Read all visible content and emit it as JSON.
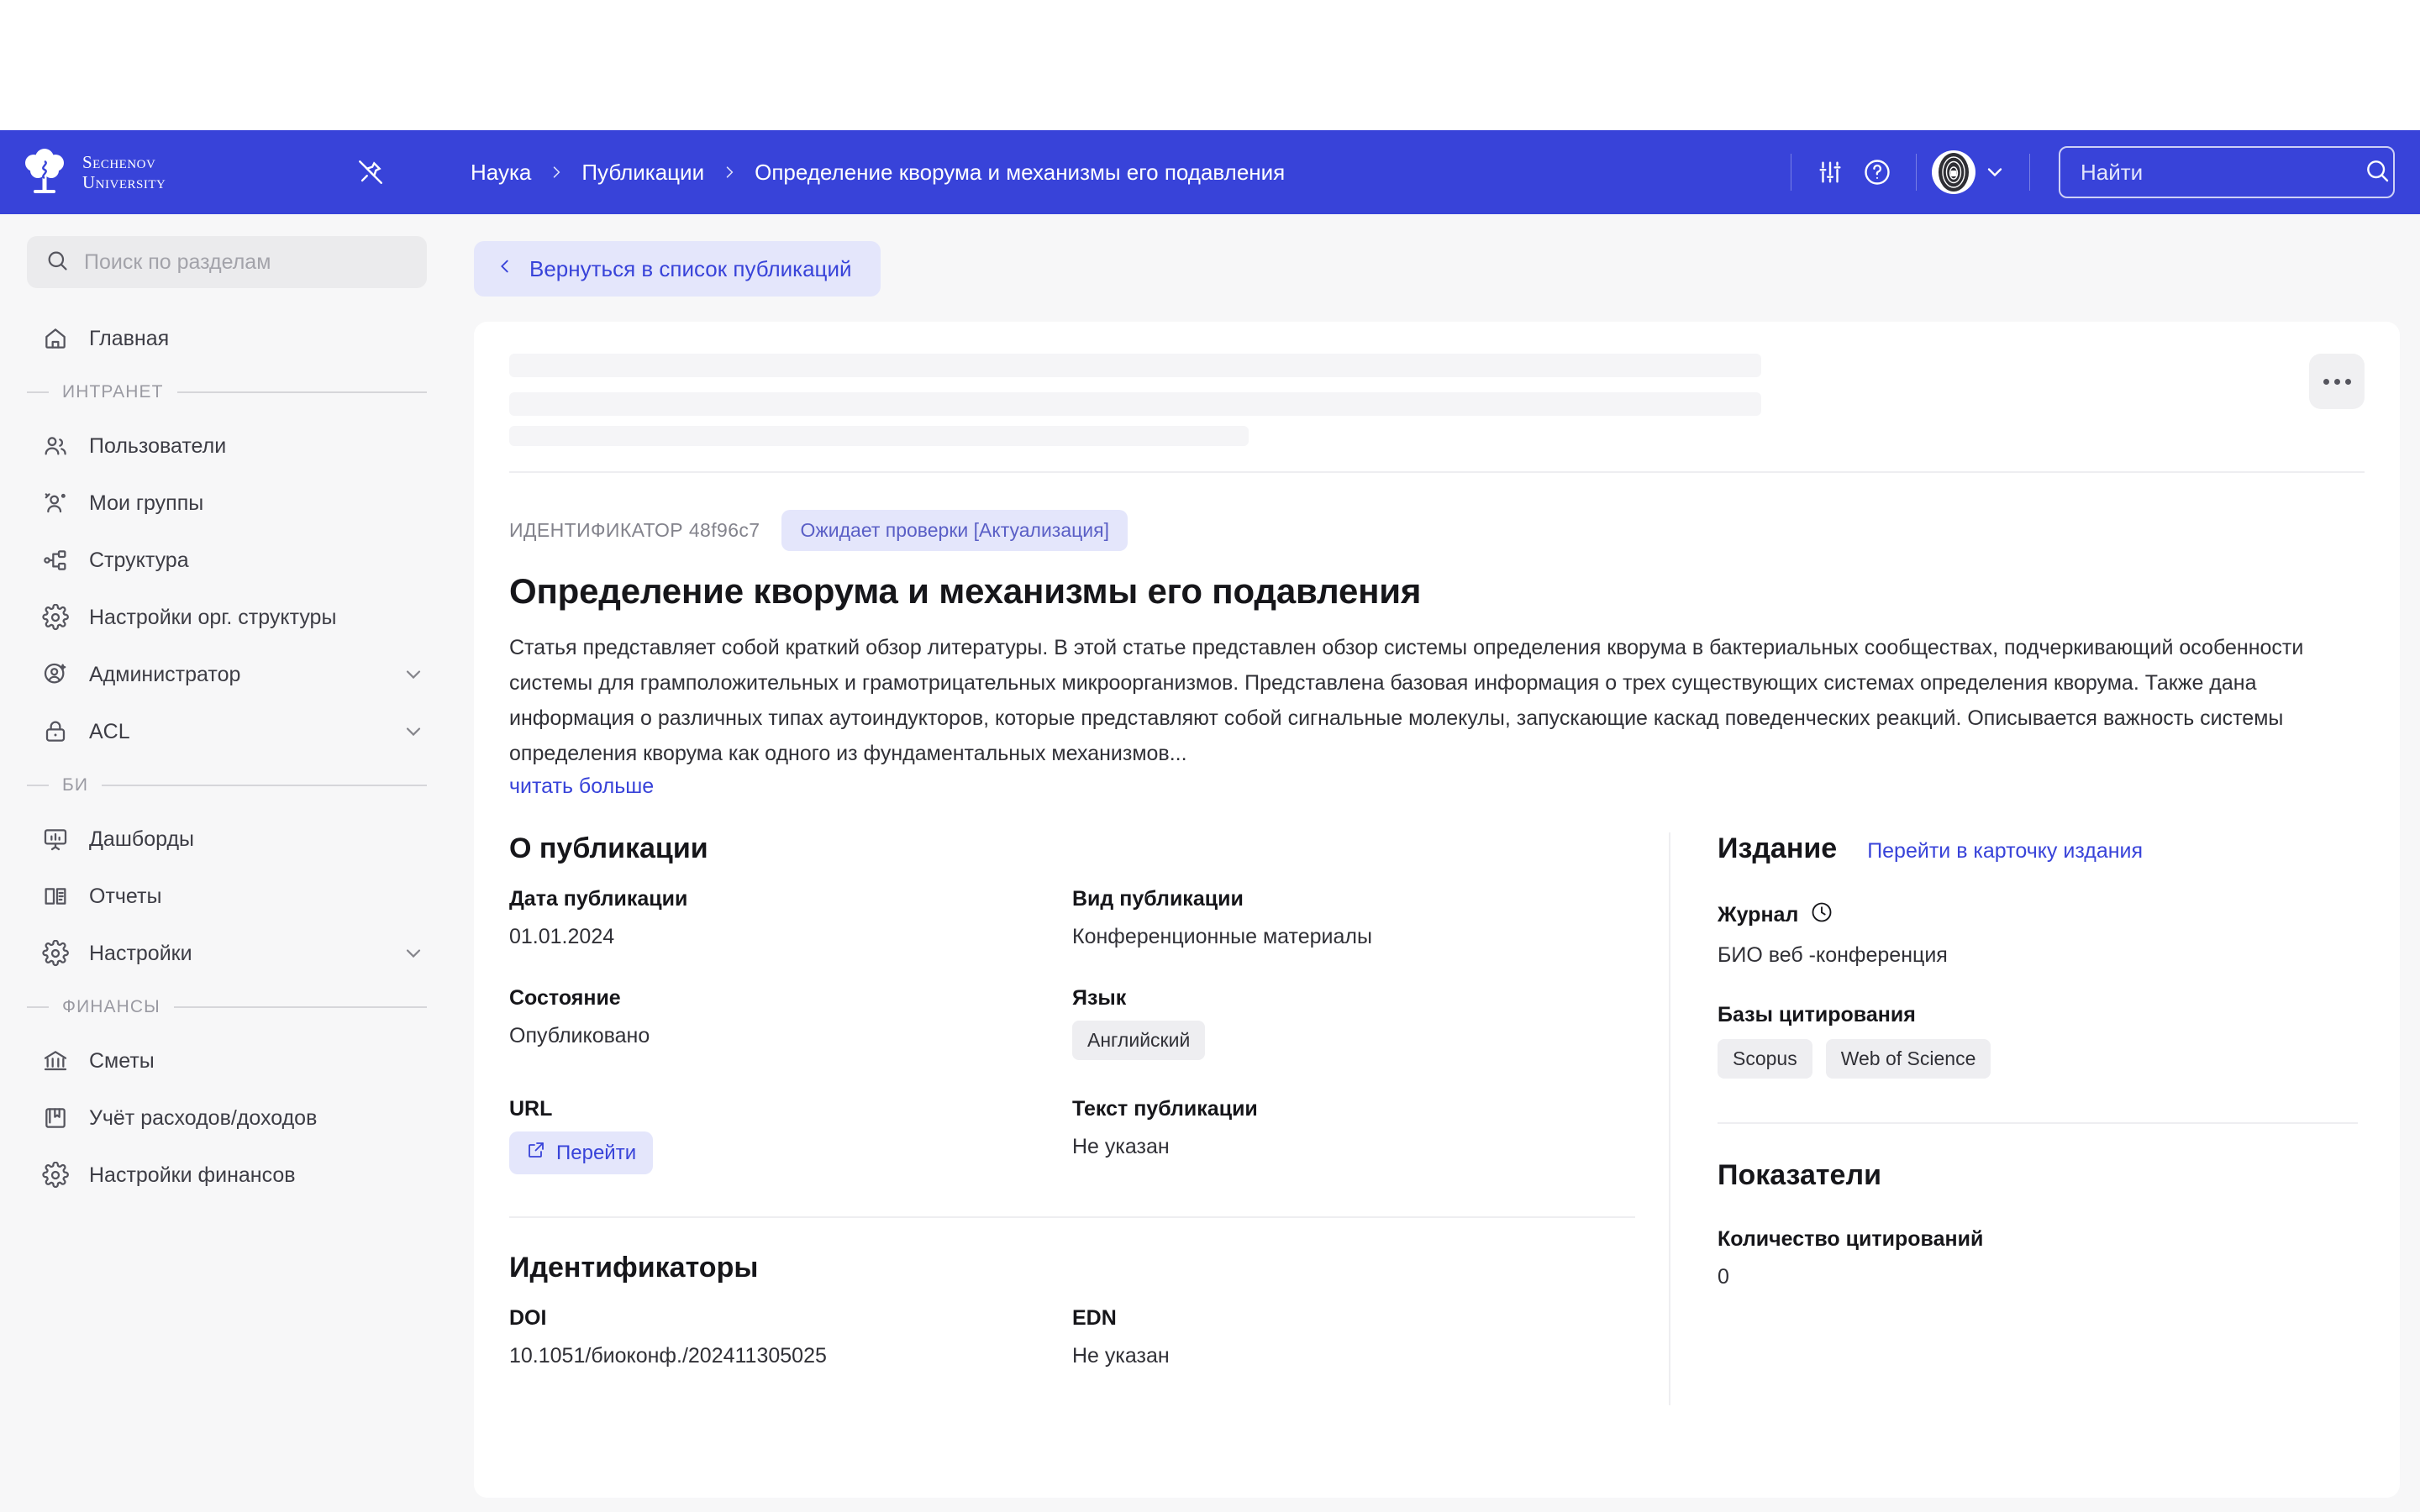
{
  "brand": {
    "logo_text": "Sechenov\nUniversity",
    "header_bg": "#3843d9",
    "accent": "#3843d9"
  },
  "header": {
    "pin_icon": "pin-off-icon",
    "breadcrumb": [
      {
        "label": "Наука",
        "current": false
      },
      {
        "label": "Публикации",
        "current": false
      },
      {
        "label": "Определение кворума и механизмы его подавления",
        "current": true
      }
    ],
    "settings_icon": "sliders-icon",
    "help_icon": "help-circle-icon",
    "avatar_icon": "fingerprint-avatar",
    "account_caret_icon": "chevron-down-icon",
    "search": {
      "placeholder": "Найти",
      "value": "",
      "icon": "search-icon"
    }
  },
  "sidebar": {
    "search": {
      "placeholder": "Поиск по разделам",
      "value": "",
      "icon": "search-icon"
    },
    "items": [
      {
        "type": "item",
        "label": "Главная",
        "icon": "home-icon",
        "caret": false
      },
      {
        "type": "group",
        "label": "ИНТРАНЕТ"
      },
      {
        "type": "item",
        "label": "Пользователи",
        "icon": "users-icon",
        "caret": false
      },
      {
        "type": "item",
        "label": "Мои группы",
        "icon": "user-group-icon",
        "caret": false
      },
      {
        "type": "item",
        "label": "Структура",
        "icon": "hierarchy-icon",
        "caret": false
      },
      {
        "type": "item",
        "label": "Настройки орг. структуры",
        "icon": "gear-icon",
        "caret": false
      },
      {
        "type": "item",
        "label": "Администратор",
        "icon": "user-admin-icon",
        "caret": true
      },
      {
        "type": "item",
        "label": "ACL",
        "icon": "lock-icon",
        "caret": true
      },
      {
        "type": "group",
        "label": "БИ"
      },
      {
        "type": "item",
        "label": "Дашборды",
        "icon": "dashboard-icon",
        "caret": false
      },
      {
        "type": "item",
        "label": "Отчеты",
        "icon": "book-icon",
        "caret": false
      },
      {
        "type": "item",
        "label": "Настройки",
        "icon": "gear-icon",
        "caret": true
      },
      {
        "type": "group",
        "label": "ФИНАНСЫ"
      },
      {
        "type": "item",
        "label": "Сметы",
        "icon": "bank-icon",
        "caret": false
      },
      {
        "type": "item",
        "label": "Учёт расходов/доходов",
        "icon": "ledger-icon",
        "caret": false
      },
      {
        "type": "item",
        "label": "Настройки финансов",
        "icon": "gear-icon",
        "caret": false
      }
    ]
  },
  "main": {
    "back_button": {
      "label": "Вернуться в список публикаций",
      "icon": "chevron-left-icon"
    },
    "more_button_icon": "ellipsis-icon",
    "identifier_label": "ИДЕНТИФИКАТОР 48f96c7",
    "status_badge": "Ожидает проверки [Актуализация]",
    "title": "Определение кворума и механизмы его подавления",
    "abstract": "Статья представляет собой краткий обзор литературы. В этой статье представлен обзор системы определения кворума в бактериальных сообществах, подчеркивающий особенности системы для грамположительных и грамотрицательных микроорганизмов. Представлена базовая информация о трех существующих системах определения кворума. Также дана информация о различных типах аутоиндукторов, которые представляют собой сигнальные молекулы, запускающие каскад поведенческих реакций. Описывается важность системы определения кворума как одного из фундаментальных механизмов...",
    "read_more": "читать больше",
    "about_section": {
      "title": "О публикации",
      "fields": [
        {
          "label": "Дата публикации",
          "value": "01.01.2024",
          "kind": "text"
        },
        {
          "label": "Вид публикации",
          "value": "Конференционные материалы",
          "kind": "text"
        },
        {
          "label": "Состояние",
          "value": "Опубликовано",
          "kind": "text"
        },
        {
          "label": "Язык",
          "value": "Английский",
          "kind": "chip"
        },
        {
          "label": "URL",
          "value": "Перейти",
          "kind": "link-chip",
          "icon": "external-link-icon"
        },
        {
          "label": "Текст публикации",
          "value": "Не указан",
          "kind": "text"
        }
      ]
    },
    "identifiers_section": {
      "title": "Идентификаторы",
      "fields": [
        {
          "label": "DOI",
          "value": "10.1051/биоконф./202411305025",
          "kind": "text"
        },
        {
          "label": "EDN",
          "value": "Не указан",
          "kind": "text"
        }
      ]
    }
  },
  "right_panel": {
    "edition": {
      "title": "Издание",
      "link": "Перейти в карточку издания",
      "journal_label": "Журнал",
      "journal_icon": "clock-icon",
      "journal_value": "БИО веб -конференция",
      "databases_label": "Базы цитирования",
      "databases": [
        "Scopus",
        "Web of Science"
      ]
    },
    "metrics": {
      "title": "Показатели",
      "citations_label": "Количество цитирований",
      "citations_value": "0"
    }
  }
}
